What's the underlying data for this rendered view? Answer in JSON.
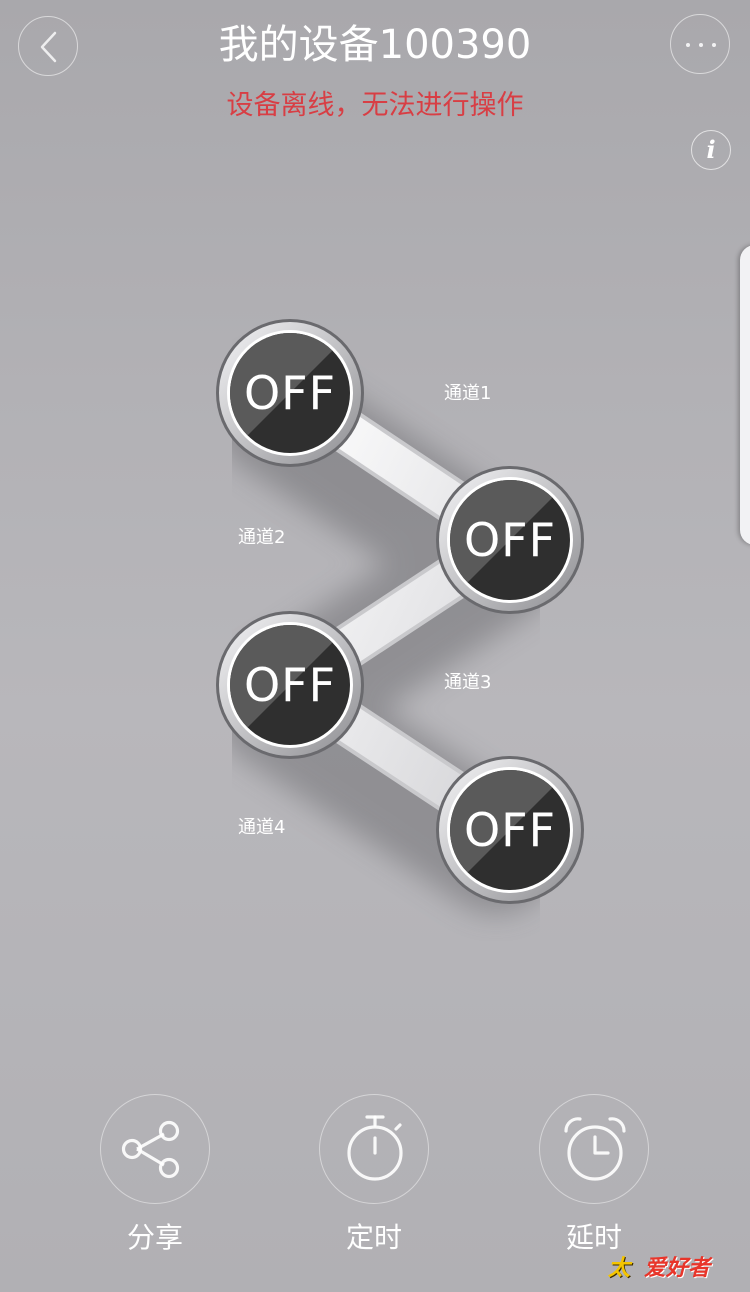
{
  "header": {
    "title": "我的设备100390",
    "offline_notice": "设备离线，无法进行操作",
    "back_icon": "chevron-left-icon",
    "more_icon": "more-horizontal-icon",
    "info_icon_glyph": "i"
  },
  "channels": [
    {
      "label": "通道1",
      "state": "OFF"
    },
    {
      "label": "通道2",
      "state": "OFF"
    },
    {
      "label": "通道3",
      "state": "OFF"
    },
    {
      "label": "通道4",
      "state": "OFF"
    }
  ],
  "actions": [
    {
      "label": "分享",
      "icon": "share-icon"
    },
    {
      "label": "定时",
      "icon": "stopwatch-icon"
    },
    {
      "label": "延时",
      "icon": "alarm-clock-icon"
    }
  ],
  "watermark": {
    "text_primary": "太",
    "text_secondary": "爱好者"
  },
  "colors": {
    "offline_notice": "#d83e44",
    "switch_face_dark": "#2f2f2f",
    "switch_face_light": "#5a5a5a"
  }
}
